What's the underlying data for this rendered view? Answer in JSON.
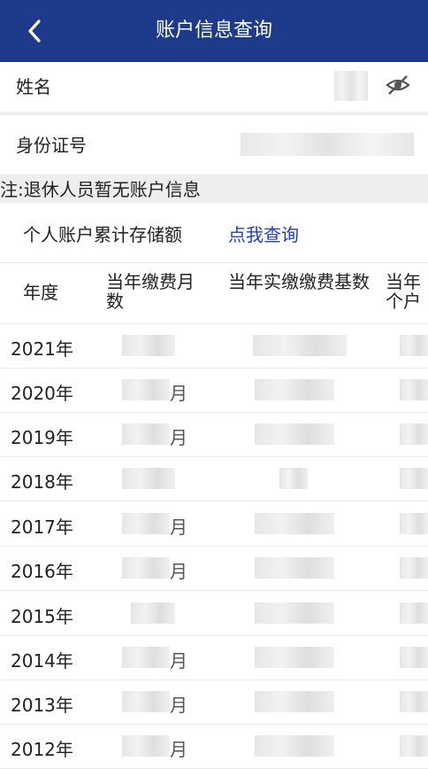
{
  "header": {
    "title": "账户信息查询"
  },
  "fields": [
    {
      "label": "姓名"
    },
    {
      "label": "身份证号"
    }
  ],
  "note": "注:退休人员暂无账户信息",
  "account": {
    "label": "个人账户累计存储额",
    "link": "点我查询"
  },
  "table": {
    "headers": [
      "年度",
      "当年缴费月数",
      "当年实缴缴费基数",
      "当年个户"
    ],
    "rows": [
      {
        "year": "2021年",
        "suffix": ""
      },
      {
        "year": "2020年",
        "suffix": "月"
      },
      {
        "year": "2019年",
        "suffix": "月"
      },
      {
        "year": "2018年",
        "suffix": ""
      },
      {
        "year": "2017年",
        "suffix": "月"
      },
      {
        "year": "2016年",
        "suffix": "月"
      },
      {
        "year": "2015年",
        "suffix": ""
      },
      {
        "year": "2014年",
        "suffix": "月"
      },
      {
        "year": "2013年",
        "suffix": "月"
      },
      {
        "year": "2012年",
        "suffix": "月"
      }
    ]
  }
}
